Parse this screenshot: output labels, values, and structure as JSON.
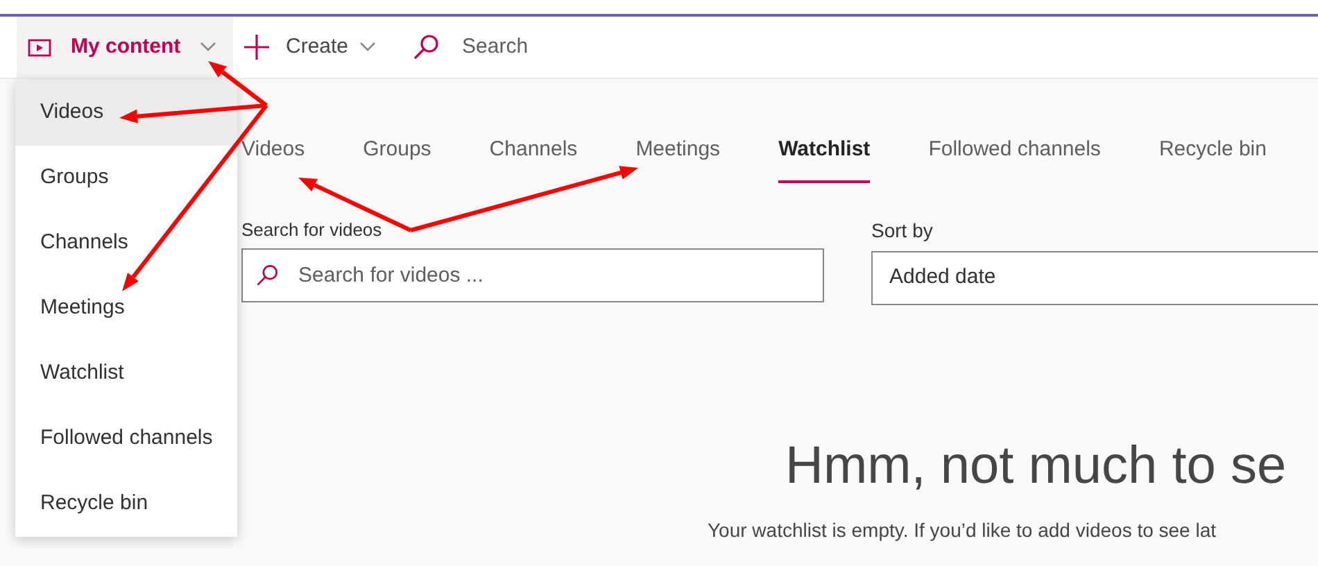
{
  "header": {
    "my_content": {
      "label": "My content",
      "expanded": true
    },
    "create": {
      "label": "Create"
    },
    "search": {
      "label": "Search"
    }
  },
  "dropdown_menu": {
    "items": [
      {
        "label": "Videos",
        "selected": true
      },
      {
        "label": "Groups",
        "selected": false
      },
      {
        "label": "Channels",
        "selected": false
      },
      {
        "label": "Meetings",
        "selected": false
      },
      {
        "label": "Watchlist",
        "selected": false
      },
      {
        "label": "Followed channels",
        "selected": false
      },
      {
        "label": "Recycle bin",
        "selected": false
      }
    ]
  },
  "tabs": [
    {
      "label": "Videos",
      "selected": false
    },
    {
      "label": "Groups",
      "selected": false
    },
    {
      "label": "Channels",
      "selected": false
    },
    {
      "label": "Meetings",
      "selected": false
    },
    {
      "label": "Watchlist",
      "selected": true
    },
    {
      "label": "Followed channels",
      "selected": false
    },
    {
      "label": "Recycle bin",
      "selected": false
    }
  ],
  "search_field": {
    "label": "Search for videos",
    "placeholder": "Search for videos ..."
  },
  "sort": {
    "label": "Sort by",
    "value": "Added date"
  },
  "empty_state": {
    "heading": "Hmm, not much to se",
    "message": "Your watchlist is empty. If you’d like to add videos to see lat"
  }
}
